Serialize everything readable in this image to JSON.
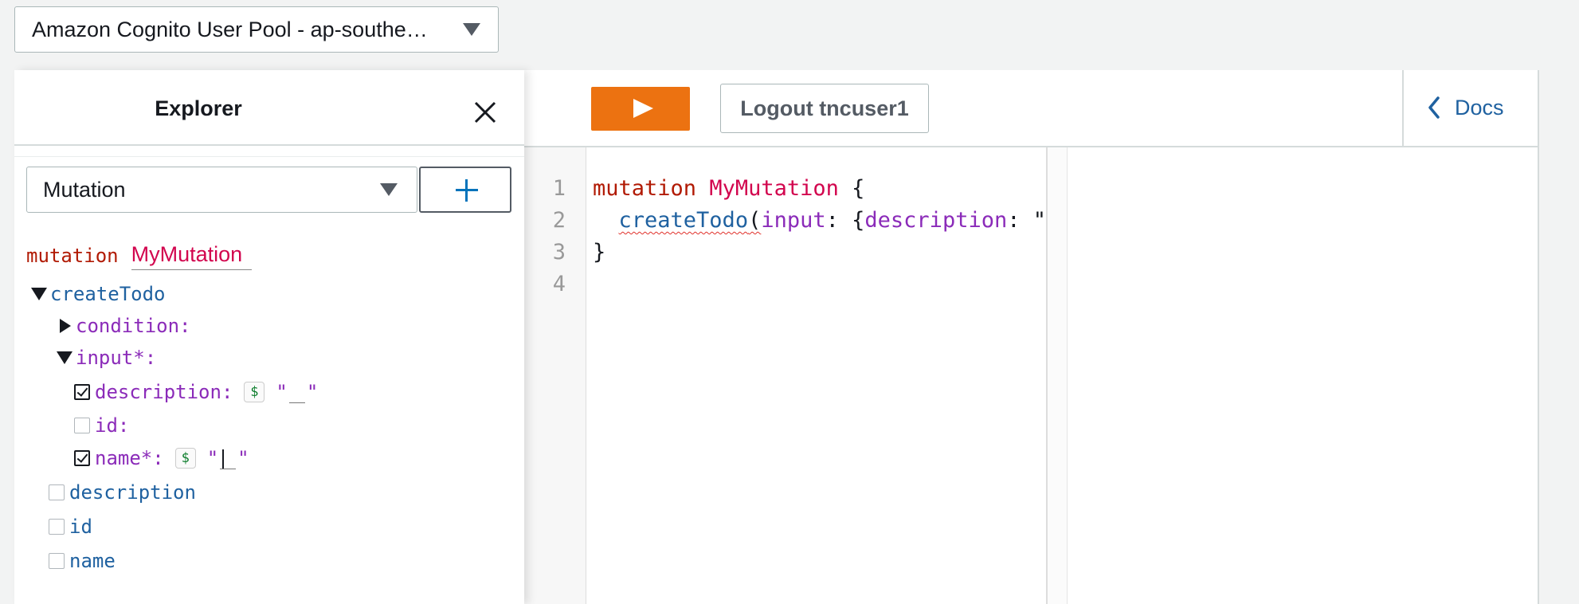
{
  "auth_mode": {
    "label": "Amazon Cognito User Pool - ap-southe…",
    "icon": "triangle-down-icon"
  },
  "explorer": {
    "title": "Explorer",
    "close_icon": "close-icon",
    "operation_type": "Mutation",
    "add_icon": "plus-icon",
    "op_keyword": "mutation",
    "op_name": "MyMutation",
    "tree": {
      "field": "createTodo",
      "condition_label": "condition:",
      "input_label": "input*:",
      "description_label": "description:",
      "id_label": "id:",
      "name_label": "name*:",
      "var_icon": "$",
      "quote_open": "\"",
      "quote_close": "\"",
      "return_fields": [
        "description",
        "id",
        "name"
      ]
    }
  },
  "toolbar": {
    "run_icon": "play-icon",
    "logout_label": "Logout tncuser1",
    "docs_label": "Docs",
    "docs_icon": "chevron-left-icon"
  },
  "editor": {
    "line_numbers": [
      "1",
      "2",
      "3",
      "4"
    ],
    "line1": {
      "kw": "mutation",
      "name": "MyMutation",
      "brace": "{"
    },
    "line2": {
      "field": "createTodo",
      "paren": "(",
      "arg": "input",
      "colon": ": {",
      "key": "description",
      "rest": ": \"'"
    },
    "line3": "}"
  }
}
